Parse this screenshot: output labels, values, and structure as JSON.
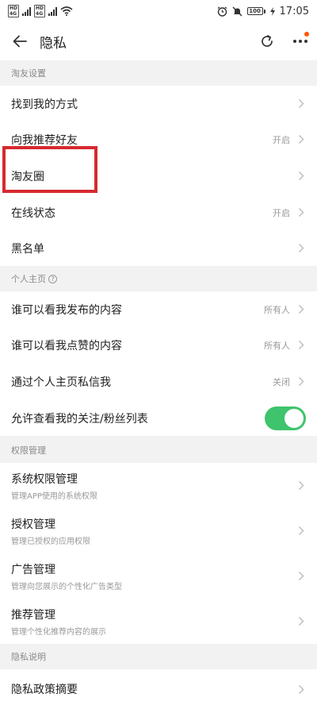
{
  "status_bar": {
    "sim1": [
      "HD",
      "4G"
    ],
    "sim2": [
      "HD",
      "4G"
    ],
    "time": "17:05",
    "battery": "100",
    "icons": [
      "alarm-icon",
      "mute-icon",
      "battery-icon",
      "charging-icon",
      "wifi-icon",
      "signal-icon"
    ]
  },
  "nav": {
    "title": "隐私",
    "back_icon": "arrow-left-icon",
    "refresh_icon": "refresh-icon",
    "more_icon": "more-icon",
    "badge_color": "#ff5500"
  },
  "sections": {
    "friends": {
      "header": "淘友设置",
      "items": [
        {
          "label": "找到我的方式",
          "value": ""
        },
        {
          "label": "向我推荐好友",
          "value": "开启"
        },
        {
          "label": "淘友圈",
          "value": ""
        },
        {
          "label": "在线状态",
          "value": "开启"
        },
        {
          "label": "黑名单",
          "value": ""
        }
      ]
    },
    "profile": {
      "header": "个人主页",
      "items": [
        {
          "label": "谁可以看我发布的内容",
          "value": "所有人"
        },
        {
          "label": "谁可以看我点赞的内容",
          "value": "所有人"
        },
        {
          "label": "通过个人主页私信我",
          "value": "关闭"
        },
        {
          "label": "允许查看我的关注/粉丝列表",
          "toggle_on": true
        }
      ]
    },
    "permissions": {
      "header": "权限管理",
      "items": [
        {
          "label": "系统权限管理",
          "sub": "管理APP使用的系统权限"
        },
        {
          "label": "授权管理",
          "sub": "管理已授权的应用权限"
        },
        {
          "label": "广告管理",
          "sub": "管理向您展示的个性化广告类型"
        },
        {
          "label": "推荐管理",
          "sub": "管理个性化推荐内容的展示"
        }
      ]
    },
    "policy": {
      "header": "隐私说明",
      "items": [
        {
          "label": "隐私政策摘要"
        }
      ]
    }
  },
  "colors": {
    "toggle_on": "#3ec46d",
    "highlight_box": "#d6292f"
  }
}
